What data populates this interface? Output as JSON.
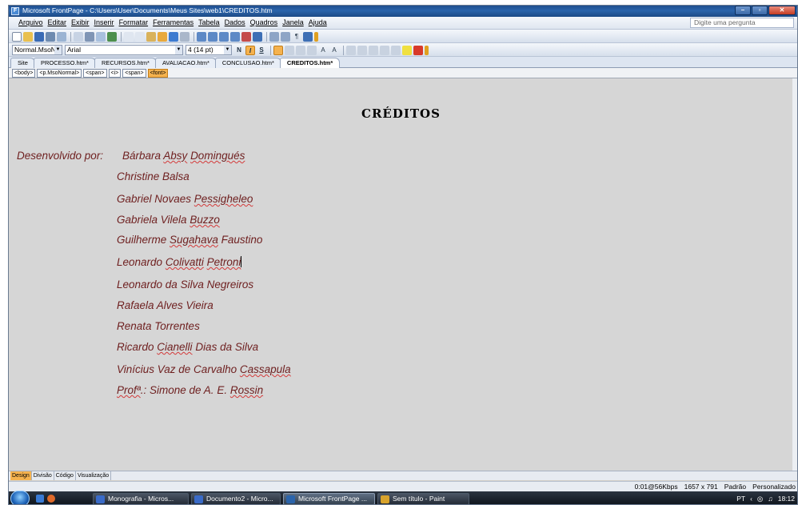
{
  "window": {
    "title": "Microsoft FrontPage - C:\\Users\\User\\Documents\\Meus Sites\\web1\\CREDITOS.htm",
    "controls": [
      "–",
      "▫",
      "✕"
    ]
  },
  "menu": {
    "items": [
      "Arquivo",
      "Editar",
      "Exibir",
      "Inserir",
      "Formatar",
      "Ferramentas",
      "Tabela",
      "Dados",
      "Quadros",
      "Janela",
      "Ajuda"
    ],
    "ask_placeholder": "Digite uma pergunta"
  },
  "formatting": {
    "style": "Normal.MsoNor",
    "font": "Arial",
    "size": "4  (14 pt)",
    "bold": "N",
    "italic": "I",
    "underline": "S"
  },
  "tabs": [
    "Site",
    "PROCESSO.htm*",
    "RECURSOS.htm*",
    "AVALIACAO.htm*",
    "CONCLUSAO.htm*",
    "CREDITOS.htm*"
  ],
  "active_tab_index": 5,
  "quick_tags": [
    "<body>",
    "<p.MsoNormal>",
    "<span>",
    "<i>",
    "<span>",
    "<font>"
  ],
  "document": {
    "heading": "CRÉDITOS",
    "developed_by_label": "Desenvolvido por:",
    "names": [
      "Bárbara Absy Domingués",
      "Christine Balsa",
      "Gabriel Novaes Pessigheleo",
      "Gabriela Vilela Buzzo",
      "Guilherme Sugahava Faustino",
      "Leonardo Colivatti Petroni",
      "Leonardo da Silva Negreiros",
      "Rafaela Alves Vieira",
      "Renata Torrentes",
      "Ricardo Cianelli Dias da Silva",
      "Vinícius Vaz de Carvalho Cassapula",
      "Profª.: Simone de A. E. Rossin"
    ]
  },
  "view_tabs": [
    "Design",
    "Divisão",
    "Código",
    "Visualização"
  ],
  "status": {
    "download": "0:01@56Kbps",
    "resolution": "1657 x 791",
    "mode": "Padrão",
    "custom": "Personalizado"
  },
  "taskbar": {
    "buttons": [
      "Monografia - Micros...",
      "Documento2 - Micro...",
      "Microsoft FrontPage ...",
      "Sem título - Paint"
    ],
    "active_index": 2,
    "language": "PT",
    "clock": "18:12"
  }
}
